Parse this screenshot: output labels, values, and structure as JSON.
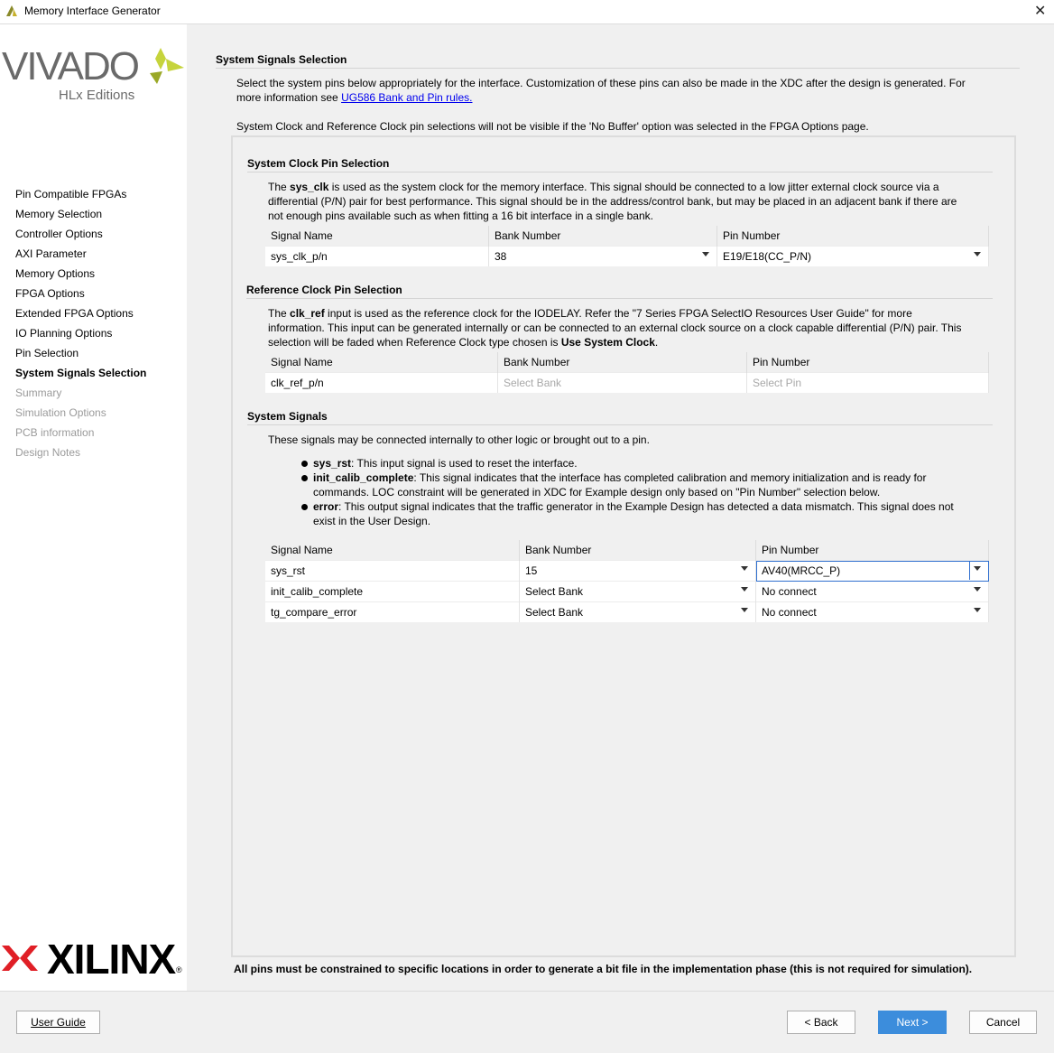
{
  "window": {
    "title": "Memory Interface Generator"
  },
  "logo": {
    "brand": "VIVADO",
    "edition": "HLx Editions",
    "company": "XILINX"
  },
  "sidebar": {
    "items": [
      {
        "label": "Pin Compatible FPGAs",
        "state": "normal"
      },
      {
        "label": "Memory Selection",
        "state": "normal"
      },
      {
        "label": "Controller Options",
        "state": "normal"
      },
      {
        "label": "AXI Parameter",
        "state": "normal"
      },
      {
        "label": "Memory Options",
        "state": "normal"
      },
      {
        "label": "FPGA Options",
        "state": "normal"
      },
      {
        "label": "Extended FPGA Options",
        "state": "normal"
      },
      {
        "label": "IO Planning Options",
        "state": "normal"
      },
      {
        "label": "Pin Selection",
        "state": "normal"
      },
      {
        "label": "System Signals Selection",
        "state": "active"
      },
      {
        "label": "Summary",
        "state": "disabled"
      },
      {
        "label": "Simulation Options",
        "state": "disabled"
      },
      {
        "label": "PCB information",
        "state": "disabled"
      },
      {
        "label": "Design Notes",
        "state": "disabled"
      }
    ]
  },
  "main": {
    "heading": "System Signals Selection",
    "intro_line1": "Select the system pins below appropriately for the interface. Customization of these pins can also be made in the XDC after the design is generated. For",
    "intro_line2_prefix": "more information see ",
    "intro_link": "UG586 Bank and Pin rules.",
    "note": "System Clock and Reference Clock pin selections will not be visible if the 'No Buffer' option was selected in the FPGA Options page.",
    "footer_note": "All pins must be constrained to specific locations in order to generate a bit file in the implementation phase (this is not required for simulation)."
  },
  "sys_clock": {
    "heading": "System Clock Pin Selection",
    "desc_pre": "The ",
    "desc_bold": "sys_clk",
    "desc_line1": " is used as the system clock for the memory interface. This signal should be connected to a low jitter external clock source via a",
    "desc_line2": "differential (P/N) pair for best performance. This signal should be in the address/control bank, but may be placed in an adjacent bank if there are",
    "desc_line3": "not enough pins available such as when fitting a 16 bit interface in a single bank.",
    "columns": [
      "Signal Name",
      "Bank Number",
      "Pin Number"
    ],
    "row": {
      "signal": "sys_clk_p/n",
      "bank": "38",
      "pin": "E19/E18(CC_P/N)"
    }
  },
  "ref_clock": {
    "heading": "Reference Clock Pin Selection",
    "desc_pre": "The ",
    "desc_bold": "clk_ref",
    "desc_line1": " input is used as the reference clock for the IODELAY. Refer the \"7 Series FPGA SelectIO Resources User Guide\" for more",
    "desc_line2": "information. This input can be generated internally or can be connected to an external clock source on a clock capable differential (P/N) pair. This",
    "desc_line3_pre": "selection will be faded when Reference Clock type chosen is ",
    "desc_line3_bold": "Use System Clock",
    "desc_line3_post": ".",
    "columns": [
      "Signal Name",
      "Bank Number",
      "Pin Number"
    ],
    "row": {
      "signal": "clk_ref_p/n",
      "bank": "Select Bank",
      "pin": "Select Pin"
    }
  },
  "system_signals": {
    "heading": "System Signals",
    "desc": "These signals may be connected internally to other logic or brought out to a pin.",
    "bullets": [
      {
        "name": "sys_rst",
        "line1": ": This input signal is used to reset the interface.",
        "line2": ""
      },
      {
        "name": "init_calib_complete",
        "line1": ": This signal indicates that the interface has completed calibration and memory initialization and is ready for",
        "line2": "commands. LOC constraint will be generated in XDC for Example design only based on \"Pin Number\" selection below."
      },
      {
        "name": "error",
        "line1": ": This output signal indicates that the traffic generator in the Example Design has detected a data mismatch. This signal does not",
        "line2": "exist in the User Design."
      }
    ],
    "columns": [
      "Signal Name",
      "Bank Number",
      "Pin Number"
    ],
    "rows": [
      {
        "signal": "sys_rst",
        "bank": "15",
        "pin": "AV40(MRCC_P)"
      },
      {
        "signal": "init_calib_complete",
        "bank": "Select Bank",
        "pin": "No connect"
      },
      {
        "signal": "tg_compare_error",
        "bank": "Select Bank",
        "pin": "No connect"
      }
    ]
  },
  "footer": {
    "user_guide": "User Guide",
    "back": "< Back",
    "next": "Next >",
    "cancel": "Cancel"
  },
  "colors": {
    "accent": "#3c8ddc",
    "vivado_green": "#c6d43c",
    "xilinx_red": "#e01f26"
  }
}
